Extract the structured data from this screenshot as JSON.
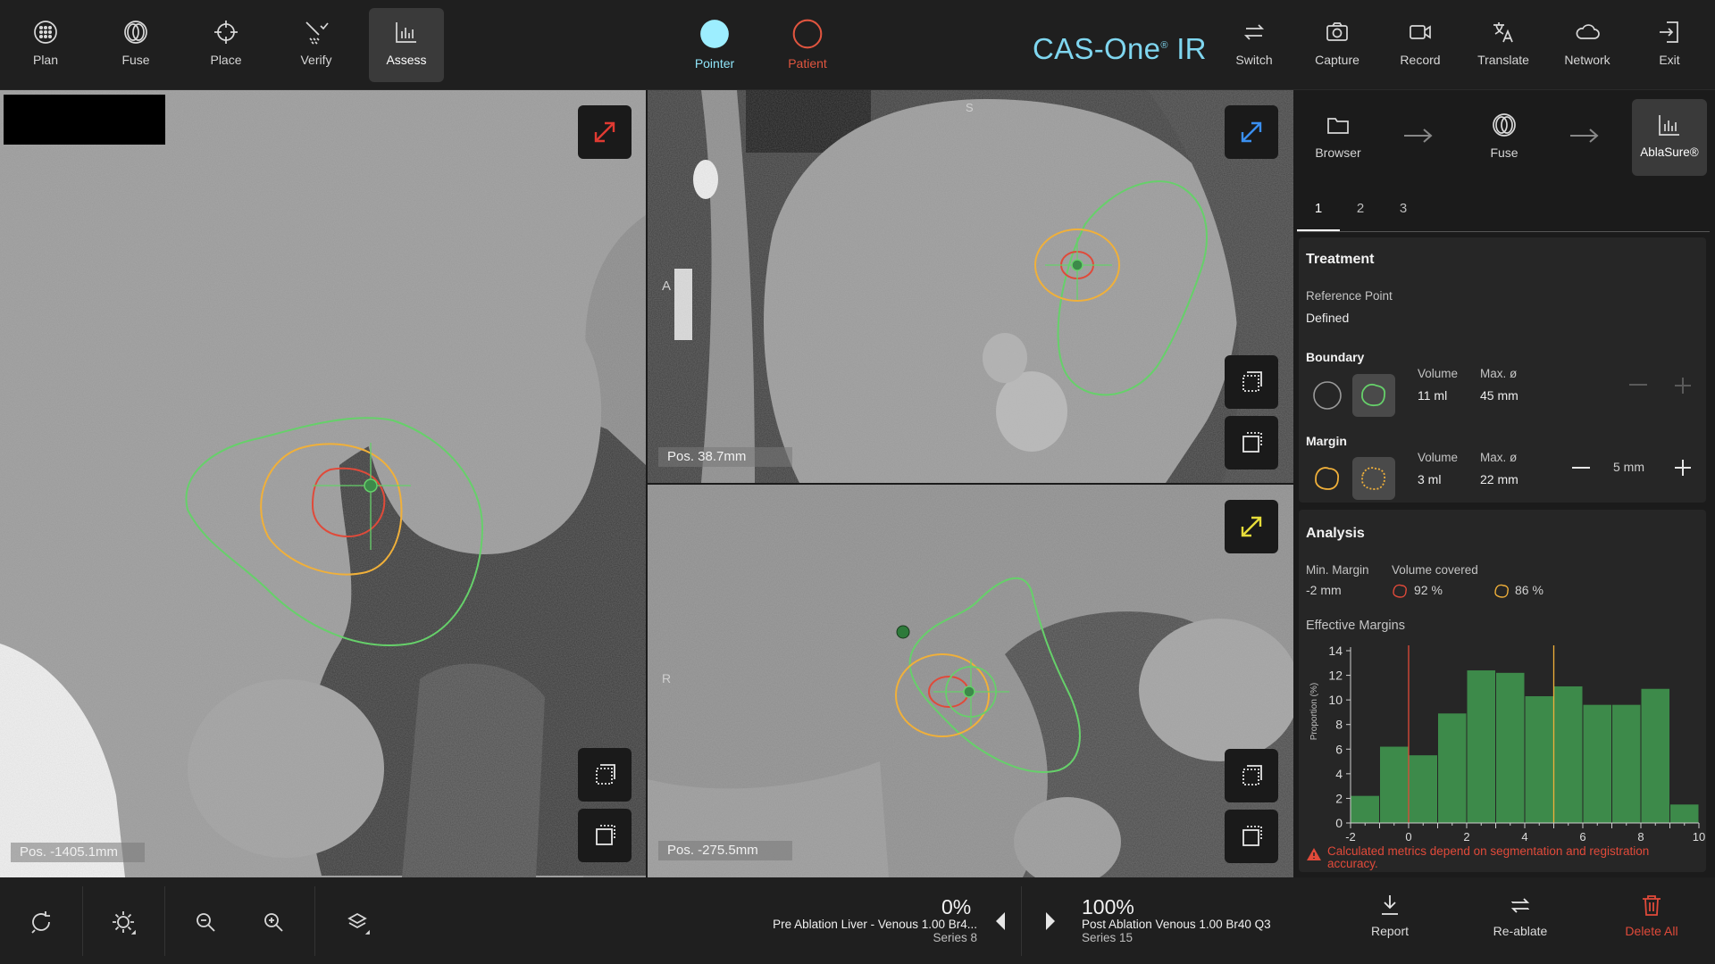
{
  "toolbar": {
    "left": [
      {
        "label": "Plan",
        "icon": "plan-icon"
      },
      {
        "label": "Fuse",
        "icon": "fuse-icon"
      },
      {
        "label": "Place",
        "icon": "crosshair-icon"
      },
      {
        "label": "Verify",
        "icon": "verify-icon"
      },
      {
        "label": "Assess",
        "icon": "bar-chart-icon",
        "active": true
      }
    ],
    "pointer_label": "Pointer",
    "patient_label": "Patient",
    "brand": "CAS-One",
    "brand_suffix": "IR",
    "brand_mark": "®",
    "right": [
      {
        "label": "Switch",
        "icon": "switch-icon"
      },
      {
        "label": "Capture",
        "icon": "camera-icon"
      },
      {
        "label": "Record",
        "icon": "video-icon"
      },
      {
        "label": "Translate",
        "icon": "translate-icon"
      },
      {
        "label": "Network",
        "icon": "cloud-icon"
      },
      {
        "label": "Exit",
        "icon": "exit-icon"
      }
    ]
  },
  "viewports": {
    "axial": {
      "pos": "Pos. -1405.1mm"
    },
    "sagittal": {
      "pos": "Pos. 38.7mm",
      "orient_left": "A",
      "orient_top": "S"
    },
    "coronal": {
      "pos": "Pos. -275.5mm",
      "orient_left": "R"
    }
  },
  "panel": {
    "workflow": [
      {
        "label": "Browser",
        "icon": "folder-icon"
      },
      {
        "label": "Fuse",
        "icon": "fuse-icon"
      },
      {
        "label": "AblaSure®",
        "icon": "bar-chart-icon",
        "active": true
      }
    ],
    "tabs": [
      "1",
      "2",
      "3"
    ],
    "treatment": {
      "title": "Treatment",
      "ref_label": "Reference Point",
      "ref_value": "Defined",
      "boundary_title": "Boundary",
      "boundary_volume_label": "Volume",
      "boundary_volume": "11 ml",
      "boundary_max_label": "Max. ø",
      "boundary_max": "45 mm",
      "margin_title": "Margin",
      "margin_volume_label": "Volume",
      "margin_volume": "3 ml",
      "margin_max_label": "Max. ø",
      "margin_max": "22 mm",
      "margin_value": "5 mm"
    },
    "analysis": {
      "title": "Analysis",
      "min_margin_label": "Min. Margin",
      "min_margin": "-2 mm",
      "volume_covered_label": "Volume covered",
      "cov_red": "92 %",
      "cov_orange": "86 %",
      "effective_label": "Effective Margins",
      "warning": "Calculated metrics depend on segmentation and registration accuracy."
    },
    "colors": {
      "green": "#3d8a4a",
      "red": "#e04a3a",
      "orange": "#f0b03a",
      "contour_green": "#66d06a"
    }
  },
  "chart_data": {
    "type": "bar",
    "ylabel": "Proportion (%)",
    "ylim": [
      0,
      14
    ],
    "xlim": [
      -2,
      10
    ],
    "yticks": [
      0,
      2,
      4,
      6,
      8,
      10,
      12,
      14
    ],
    "xticks": [
      -2,
      0,
      2,
      4,
      6,
      8,
      10
    ],
    "bin_width": 1,
    "x": [
      -2,
      -1,
      0,
      1,
      2,
      3,
      4,
      5,
      6,
      7,
      8
    ],
    "values": [
      2.2,
      6.2,
      5.5,
      8.9,
      12.4,
      12.2,
      10.3,
      11.1,
      9.6,
      9.6,
      10.9,
      1.5
    ],
    "vlines": [
      {
        "x": 0,
        "color": "#e04a3a"
      },
      {
        "x": 5,
        "color": "#f0b03a"
      }
    ]
  },
  "bottom": {
    "left_pct": "0%",
    "left_series_name": "Pre Ablation Liver - Venous 1.00 Br4...",
    "left_series_no": "Series 8",
    "right_pct": "100%",
    "right_series_name": "Post Ablation Venous 1.00 Br40 Q3",
    "right_series_no": "Series 15",
    "actions": [
      {
        "label": "Report",
        "icon": "download-icon"
      },
      {
        "label": "Re-ablate",
        "icon": "repeat-icon"
      },
      {
        "label": "Delete All",
        "icon": "trash-icon"
      }
    ]
  }
}
